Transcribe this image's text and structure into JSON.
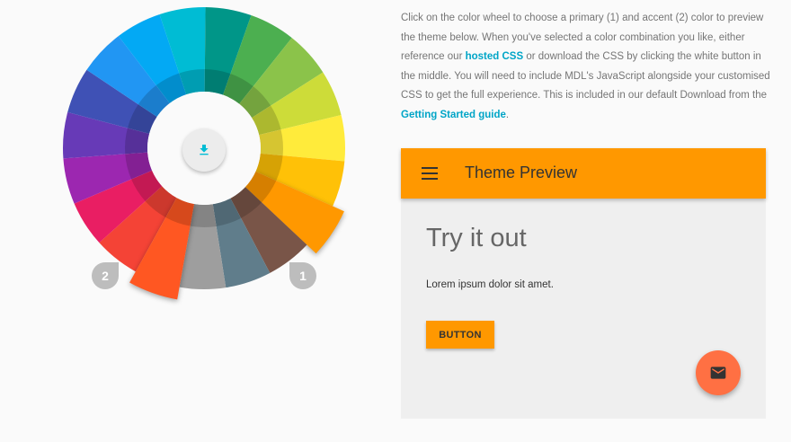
{
  "intro": {
    "text_1": "Click on the color wheel to choose a primary (1) and accent (2) color to preview the theme below. When you've selected a color combination you like, either reference our ",
    "link_hosted": "hosted CSS",
    "text_2": " or download the CSS by clicking the white button in the middle. You will need to include MDL's JavaScript alongside your customised CSS to get the full experience. This is included in our default Download from the ",
    "link_guide": "Getting Started guide",
    "text_3": "."
  },
  "wheel": {
    "colors": [
      {
        "name": "red",
        "value": "#f44336"
      },
      {
        "name": "pink",
        "value": "#e91e63"
      },
      {
        "name": "purple",
        "value": "#9c27b0"
      },
      {
        "name": "deep-purple",
        "value": "#673ab7"
      },
      {
        "name": "indigo",
        "value": "#3f51b5"
      },
      {
        "name": "blue",
        "value": "#2196f3"
      },
      {
        "name": "light-blue",
        "value": "#03a9f4"
      },
      {
        "name": "cyan",
        "value": "#00bcd4"
      },
      {
        "name": "teal",
        "value": "#009688"
      },
      {
        "name": "green",
        "value": "#4caf50"
      },
      {
        "name": "light-green",
        "value": "#8bc34a"
      },
      {
        "name": "lime",
        "value": "#cddc39"
      },
      {
        "name": "yellow",
        "value": "#ffeb3b"
      },
      {
        "name": "amber",
        "value": "#ffc107"
      },
      {
        "name": "orange",
        "value": "#ff9800"
      },
      {
        "name": "brown",
        "value": "#795548"
      },
      {
        "name": "blue-grey",
        "value": "#607d8b"
      },
      {
        "name": "grey",
        "value": "#9e9e9e"
      },
      {
        "name": "deep-orange",
        "value": "#ff5722"
      }
    ],
    "primary": "orange",
    "accent": "deep-orange",
    "download_icon": "download-icon",
    "marker_primary": "1",
    "marker_accent": "2"
  },
  "preview": {
    "title": "Theme Preview",
    "heading": "Try it out",
    "body": "Lorem ipsum dolor sit amet.",
    "button_label": "BUTTON",
    "primary_color": "#ff9800",
    "accent_color": "#ff7043",
    "fab_icon": "mail-icon"
  }
}
